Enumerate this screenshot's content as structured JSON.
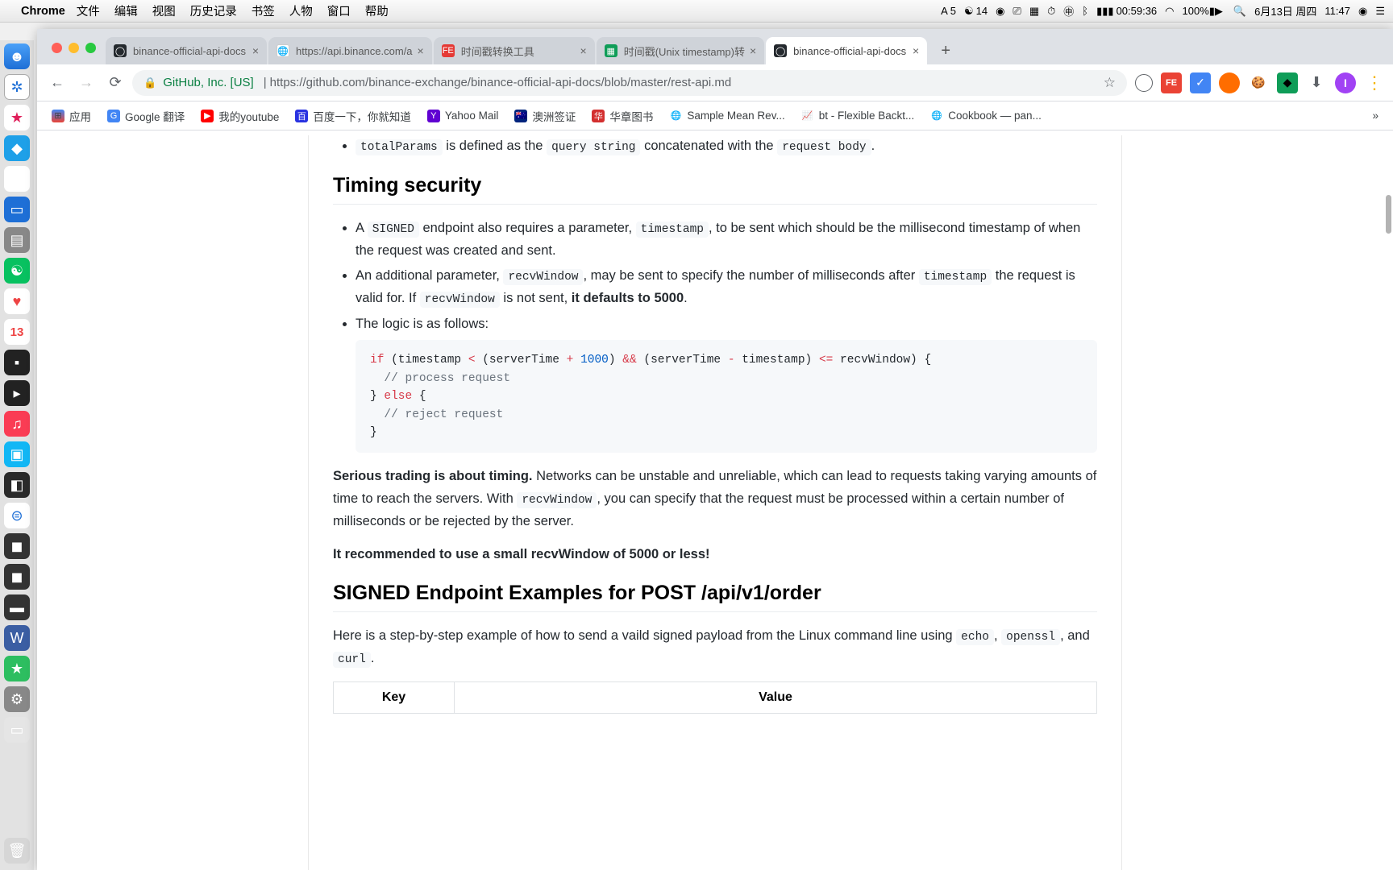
{
  "menubar": {
    "app": "Chrome",
    "items": [
      "文件",
      "编辑",
      "视图",
      "历史记录",
      "书签",
      "人物",
      "窗口",
      "帮助"
    ],
    "right": {
      "a_badge": "A 5",
      "wechat": "14",
      "timer": "00:59:36",
      "battery": "100%",
      "date": "6月13日 周四",
      "time": "11:47"
    }
  },
  "dock": {
    "cal_day": "13"
  },
  "tabs": [
    {
      "title": "binance-official-api-docs",
      "fav": "gh"
    },
    {
      "title": "https://api.binance.com/a",
      "fav": "globe"
    },
    {
      "title": "时间戳转换工具",
      "fav": "fe"
    },
    {
      "title": "时间戳(Unix timestamp)转",
      "fav": "sheet"
    },
    {
      "title": "binance-official-api-docs",
      "fav": "gh",
      "active": true
    }
  ],
  "omnibox": {
    "origin": "GitHub, Inc. [US]",
    "url": "https://github.com/binance-exchange/binance-official-api-docs/blob/master/rest-api.md"
  },
  "bookmarks": [
    {
      "label": "应用",
      "ic": "apps"
    },
    {
      "label": "Google 翻译",
      "ic": "g"
    },
    {
      "label": "我的youtube",
      "ic": "yt"
    },
    {
      "label": "百度一下，你就知道",
      "ic": "bd"
    },
    {
      "label": "Yahoo Mail",
      "ic": "y"
    },
    {
      "label": "澳洲签证",
      "ic": "au"
    },
    {
      "label": "华章图书",
      "ic": "hz"
    },
    {
      "label": "Sample Mean Rev...",
      "ic": "globe"
    },
    {
      "label": "bt - Flexible Backt...",
      "ic": "chart"
    },
    {
      "label": "Cookbook — pan...",
      "ic": "globe"
    }
  ],
  "doc": {
    "top_line": {
      "prefix": "",
      "code1": "totalParams",
      "mid": " is defined as the ",
      "code2": "query string",
      "mid2": " concatenated with the ",
      "code3": "request body",
      "suffix": "."
    },
    "h2_timing": "Timing security",
    "bullet1": {
      "t1": "A ",
      "c1": "SIGNED",
      "t2": " endpoint also requires a parameter, ",
      "c2": "timestamp",
      "t3": ", to be sent which should be the millisecond timestamp of when the request was created and sent."
    },
    "bullet2": {
      "t1": "An additional parameter, ",
      "c1": "recvWindow",
      "t2": ", may be sent to specify the number of milliseconds after ",
      "c2": "timestamp",
      "t3": " the request is valid for. If ",
      "c3": "recvWindow",
      "t4": " is not sent, ",
      "b1": "it defaults to 5000",
      "t5": "."
    },
    "bullet3": "The logic is as follows:",
    "code": {
      "l1a": "if",
      "l1b": " (timestamp ",
      "l1c": "<",
      "l1d": " (serverTime ",
      "l1e": "+",
      "l1f": " ",
      "l1g": "1000",
      "l1h": ") ",
      "l1i": "&&",
      "l1j": " (serverTime ",
      "l1k": "-",
      "l1l": " timestamp) ",
      "l1m": "<=",
      "l1n": " recvWindow) {",
      "l2": "// process request",
      "l3a": "} ",
      "l3b": "else",
      "l3c": " {",
      "l4": "// reject request",
      "l5": "}"
    },
    "p1": {
      "b": "Serious trading is about timing.",
      "t1": " Networks can be unstable and unreliable, which can lead to requests taking varying amounts of time to reach the servers. With ",
      "c1": "recvWindow",
      "t2": ", you can specify that the request must be processed within a certain number of milliseconds or be rejected by the server."
    },
    "p2": "It recommended to use a small recvWindow of 5000 or less!",
    "h2_signed": "SIGNED Endpoint Examples for POST /api/v1/order",
    "p3": {
      "t1": "Here is a step-by-step example of how to send a vaild signed payload from the Linux command line using ",
      "c1": "echo",
      "t2": ", ",
      "c2": "openssl",
      "t3": ", and ",
      "c3": "curl",
      "t4": "."
    },
    "table": {
      "th1": "Key",
      "th2": "Value"
    }
  }
}
